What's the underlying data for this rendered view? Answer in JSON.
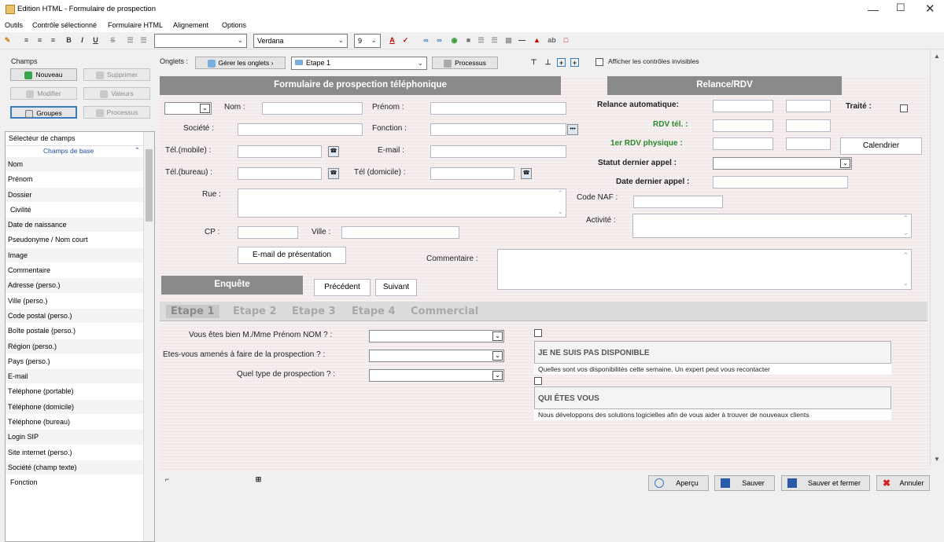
{
  "window": {
    "title": "Edition HTML - Formulaire de prospection"
  },
  "menu": [
    "Outils",
    "Contrôle sélectionné",
    "Formulaire HTML",
    "Alignement",
    "Options"
  ],
  "toolbar": {
    "font": "Verdana",
    "size": "9"
  },
  "left": {
    "section": "Champs",
    "btn_new": "Nouveau",
    "btn_delete": "Supprimer",
    "btn_modify": "Modifier",
    "btn_values": "Valeurs",
    "btn_groups": "Groupes",
    "btn_process": "Processus",
    "selector_title": "Sélecteur de champs",
    "group_title": "Champs de base",
    "fields": [
      "Nom",
      "Prénom",
      "Dossier",
      "Civilité",
      "Date de naissance",
      "Pseudonyme / Nom court",
      "Image",
      "Commentaire",
      "Adresse (perso.)",
      "Ville (perso.)",
      "Code postal (perso.)",
      "Boîte postale (perso.)",
      "Région (perso.)",
      "Pays (perso.)",
      "E-mail",
      "Téléphone (portable)",
      "Téléphone (domicile)",
      "Téléphone (bureau)",
      "Login SIP",
      "Site internet (perso.)",
      "Société (champ texte)",
      "Fonction"
    ]
  },
  "topbar": {
    "onglets": "Onglets :",
    "manage": "Gérer les onglets",
    "current": "Etape 1",
    "process": "Processus",
    "show_invisible": "Afficher les contrôles invisibles"
  },
  "form": {
    "title1": "Formulaire de prospection téléphonique",
    "title2": "Relance/RDV",
    "nom": "Nom :",
    "prenom": "Prénom :",
    "societe": "Société :",
    "fonction": "Fonction :",
    "tel_mobile": "Tél.(mobile) :",
    "email": "E-mail :",
    "tel_bureau": "Tél.(bureau) :",
    "tel_domicile": "Tél (domicile) :",
    "rue": "Rue :",
    "cp": "CP :",
    "ville": "Ville :",
    "btn_email": "E-mail de présentation",
    "relance": "Relance automatique:",
    "traite": "Traité :",
    "rdv_tel": "RDV tél. :",
    "rdv_phys": "1er RDV physique :",
    "calendrier": "Calendrier",
    "statut": "Statut dernier appel :",
    "date_appel": "Date dernier appel :",
    "code_naf": "Code NAF :",
    "activite": "Activité :",
    "commentaire": "Commentaire :",
    "enquete": "Enquête",
    "precedent": "Précédent",
    "suivant": "Suivant",
    "tabs": [
      "Etape 1",
      "Etape 2",
      "Etape 3",
      "Etape 4",
      "Commercial"
    ],
    "q1": "Vous êtes bien M./Mme Prénom NOM ? :",
    "q2": "Etes-vous amenés à faire de la prospection ? :",
    "q3": "Quel type de prospection ? :",
    "box1_title": "JE NE SUIS PAS DISPONIBLE",
    "box1_sub": "Quelles sont vos disponibilités cette semaine. Un expert peut vous recontacter",
    "box2_title": "QUI ÊTES VOUS",
    "box2_sub": "Nous développons des solutions logicielles afin de vous aider à trouver de nouveaux clients"
  },
  "bottom": {
    "apercu": "Aperçu",
    "sauver": "Sauver",
    "sauver_fermer": "Sauver et fermer",
    "annuler": "Annuler"
  }
}
